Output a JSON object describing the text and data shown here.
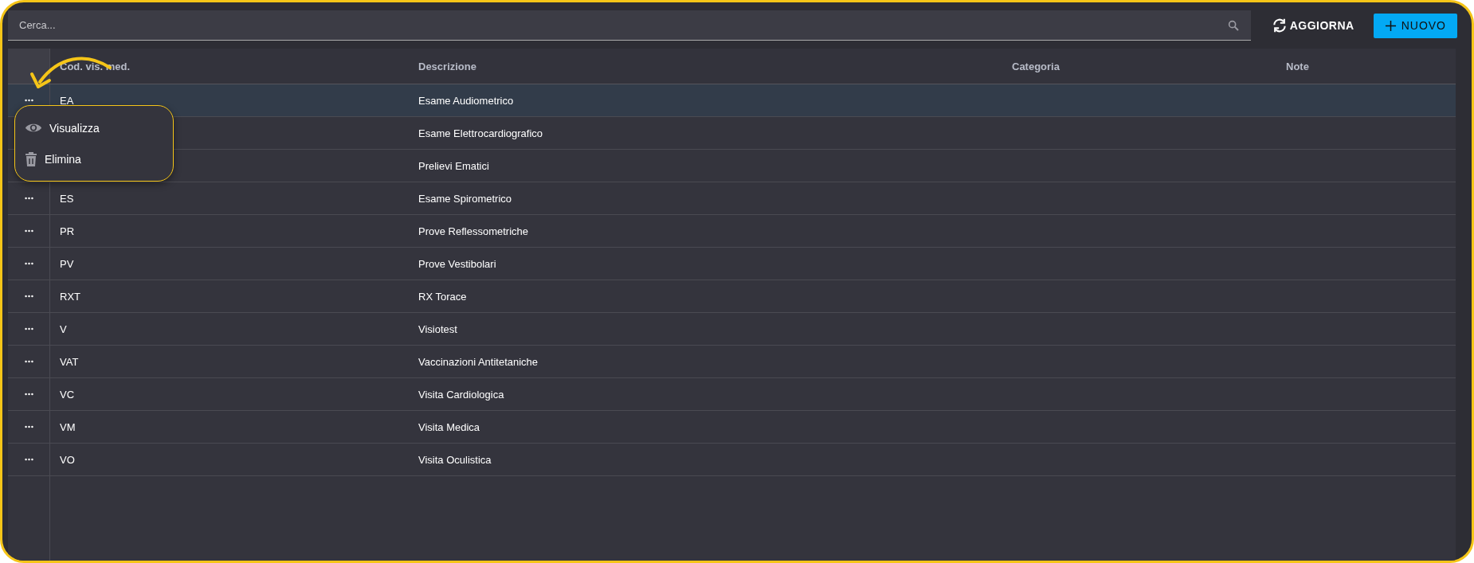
{
  "search": {
    "placeholder": "Cerca..."
  },
  "toolbar": {
    "refresh": "AGGIORNA",
    "new": "NUOVO"
  },
  "table": {
    "columns": [
      "Cod. vis. med.",
      "Descrizione",
      "Categoria",
      "Note"
    ],
    "rows": [
      {
        "code": "EA",
        "description": "Esame Audiometrico",
        "selected": true,
        "more_button": true
      },
      {
        "description": "Esame Elettrocardiografico",
        "selected": false,
        "more_button": false
      },
      {
        "description": "Prelievi Ematici",
        "selected": false,
        "more_button": false
      },
      {
        "code": "ES",
        "description": "Esame Spirometrico",
        "selected": false,
        "more_button": true
      },
      {
        "code": "PR",
        "description": "Prove Reflessometriche",
        "selected": false,
        "more_button": true
      },
      {
        "code": "PV",
        "description": "Prove Vestibolari",
        "selected": false,
        "more_button": true
      },
      {
        "code": "RXT",
        "description": "RX Torace",
        "selected": false,
        "more_button": true
      },
      {
        "code": "V",
        "description": "Visiotest",
        "selected": false,
        "more_button": true
      },
      {
        "code": "VAT",
        "description": "Vaccinazioni Antitetaniche",
        "selected": false,
        "more_button": true
      },
      {
        "code": "VC",
        "description": "Visita Cardiologica",
        "selected": false,
        "more_button": true
      },
      {
        "code": "VM",
        "description": "Visita Medica",
        "selected": false,
        "more_button": true
      },
      {
        "code": "VO",
        "description": "Visita Oculistica",
        "selected": false,
        "more_button": true
      }
    ]
  },
  "context_menu": {
    "items": [
      {
        "kind": "view",
        "label": "Visualizza"
      },
      {
        "kind": "delete",
        "label": "Elimina"
      }
    ]
  }
}
